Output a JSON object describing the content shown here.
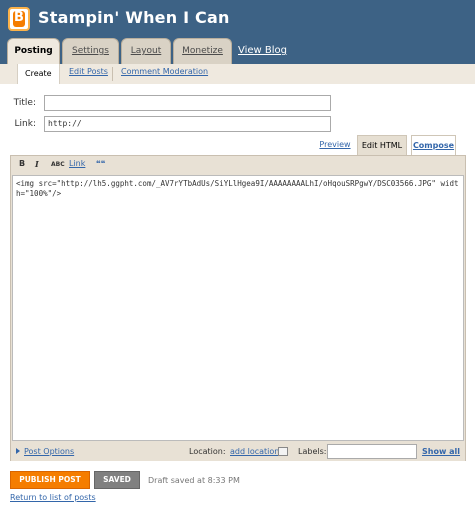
{
  "header": {
    "blog_title": "Stampin' When I Can",
    "tabs": [
      "Posting",
      "Settings",
      "Layout",
      "Monetize"
    ],
    "view_blog": "View Blog"
  },
  "subnav": [
    "Create",
    "Edit Posts",
    "Comment Moderation"
  ],
  "form": {
    "title_label": "Title:",
    "title_value": "",
    "link_label": "Link:",
    "link_value": "http://"
  },
  "modes": {
    "preview": "Preview",
    "edit_html": "Edit HTML",
    "compose": "Compose"
  },
  "toolbar": {
    "bold": "B",
    "italic": "I",
    "spell": "ABC",
    "link": "Link",
    "quote": "❝❝"
  },
  "editor": {
    "content": "<img src=\"http://lh5.ggpht.com/_AV7rYTbAdUs/SiYLlHgea9I/AAAAAAAALhI/oHqouSRPgwY/DSC03566.JPG\" width=\"100%\"/>"
  },
  "footer": {
    "post_options": "Post Options",
    "location_label": "Location:",
    "add_location": "add location",
    "labels_label": "Labels:",
    "labels_value": "",
    "show_all": "Show all"
  },
  "actions": {
    "publish": "PUBLISH POST",
    "saved": "SAVED",
    "status": "Draft saved at 8:33 PM",
    "return_link": "Return to list of posts"
  },
  "colors": {
    "header": "#3d6285",
    "publish": "#f57d00",
    "link": "#3366aa"
  }
}
